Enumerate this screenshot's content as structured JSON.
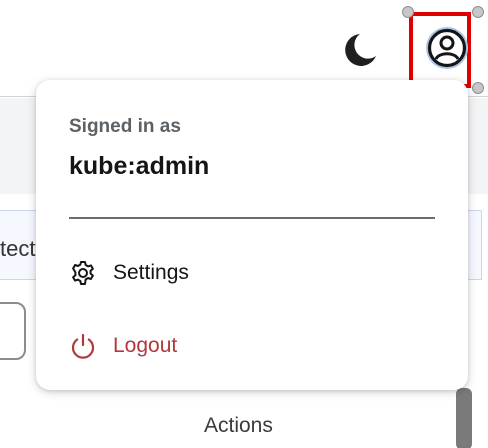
{
  "masthead": {
    "theme_icon": "moon-icon",
    "user_icon": "user-circle-icon"
  },
  "background": {
    "input_fragment": "tect",
    "actions_label": "Actions"
  },
  "user_menu": {
    "signed_in_label": "Signed in as",
    "username": "kube:admin",
    "items": [
      {
        "label": "Settings",
        "icon": "gear-icon",
        "color": "#151515"
      },
      {
        "label": "Logout",
        "icon": "power-icon",
        "color": "#b1383d"
      }
    ]
  },
  "colors": {
    "selection_outline": "#e10000",
    "logout": "#b1383d"
  }
}
